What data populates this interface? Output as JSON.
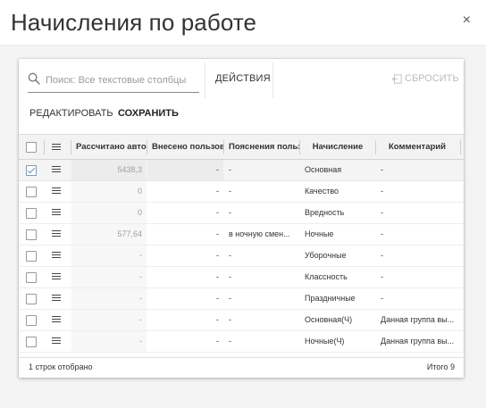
{
  "dialog": {
    "title": "Начисления по работе",
    "close_symbol": "×"
  },
  "toolbar": {
    "search_placeholder": "Поиск: Все текстовые столбцы",
    "actions_label": "ДЕЙСТВИЯ",
    "reset_label": "СБРОСИТЬ",
    "edit_label": "РЕДАКТИРОВАТЬ",
    "save_label": "СОХРАНИТЬ"
  },
  "grid": {
    "columns": [
      "Рассчитано автом",
      "Внесено пользова",
      "Пояснения пользо",
      "Начисление",
      "Комментарий"
    ],
    "rows": [
      {
        "checked": true,
        "calc": "5438,3",
        "entered": "-",
        "note": "-",
        "accrual": "Основная",
        "comment": "-"
      },
      {
        "checked": false,
        "calc": "0",
        "entered": "-",
        "note": "-",
        "accrual": "Качество",
        "comment": "-"
      },
      {
        "checked": false,
        "calc": "0",
        "entered": "-",
        "note": "-",
        "accrual": "Вредность",
        "comment": "-"
      },
      {
        "checked": false,
        "calc": "577,64",
        "entered": "-",
        "note": "в ночную смен...",
        "accrual": "Ночные",
        "comment": "-"
      },
      {
        "checked": false,
        "calc": "-",
        "entered": "-",
        "note": "-",
        "accrual": "Уборочные",
        "comment": "-"
      },
      {
        "checked": false,
        "calc": "-",
        "entered": "-",
        "note": "-",
        "accrual": "Классность",
        "comment": "-"
      },
      {
        "checked": false,
        "calc": "-",
        "entered": "-",
        "note": "-",
        "accrual": "Праздничные",
        "comment": "-"
      },
      {
        "checked": false,
        "calc": "-",
        "entered": "-",
        "note": "-",
        "accrual": "Основная(Ч)",
        "comment": "Данная группа вы..."
      },
      {
        "checked": false,
        "calc": "-",
        "entered": "-",
        "note": "-",
        "accrual": "Ночные(Ч)",
        "comment": "Данная группа вы..."
      }
    ]
  },
  "footer": {
    "selected_text": "1 строк отобрано",
    "total_text": "Итого 9"
  },
  "colors": {
    "accent": "#6f8faf",
    "header_bg": "#f3f3f3",
    "body_bg": "#f4f4f4"
  }
}
